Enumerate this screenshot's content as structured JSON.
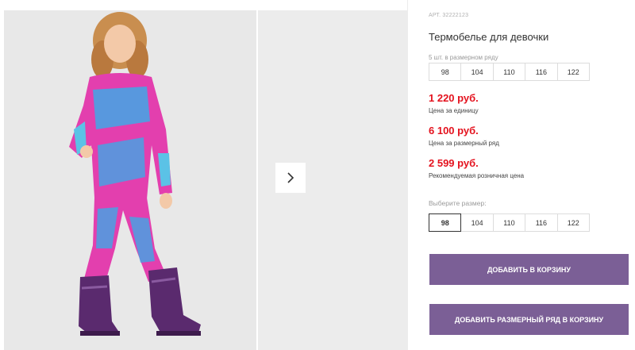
{
  "product": {
    "article": "АРТ. 32222123",
    "title": "Термобелье для девочки"
  },
  "pack": {
    "label": "5 шт. в размерном ряду",
    "sizes": [
      "98",
      "104",
      "110",
      "116",
      "122"
    ]
  },
  "prices": [
    {
      "amount": "1 220 руб.",
      "note": "Цена за единицу"
    },
    {
      "amount": "6 100 руб.",
      "note": "Цена за размерный ряд"
    },
    {
      "amount": "2 599 руб.",
      "note": "Рекомендуемая розничная цена"
    }
  ],
  "size_select": {
    "label": "Выберите размер:",
    "sizes": [
      "98",
      "104",
      "110",
      "116",
      "122"
    ],
    "selected": "98"
  },
  "buttons": {
    "add_to_cart": "ДОБАВИТЬ В КОРЗИНУ",
    "add_pack_to_cart": "ДОБАВИТЬ РАЗМЕРНЫЙ РЯД В КОРЗИНУ"
  },
  "colors": {
    "accent": "#7b5f96",
    "price": "#e4121e"
  },
  "icons": {
    "gallery_next": "chevron-right-icon"
  }
}
